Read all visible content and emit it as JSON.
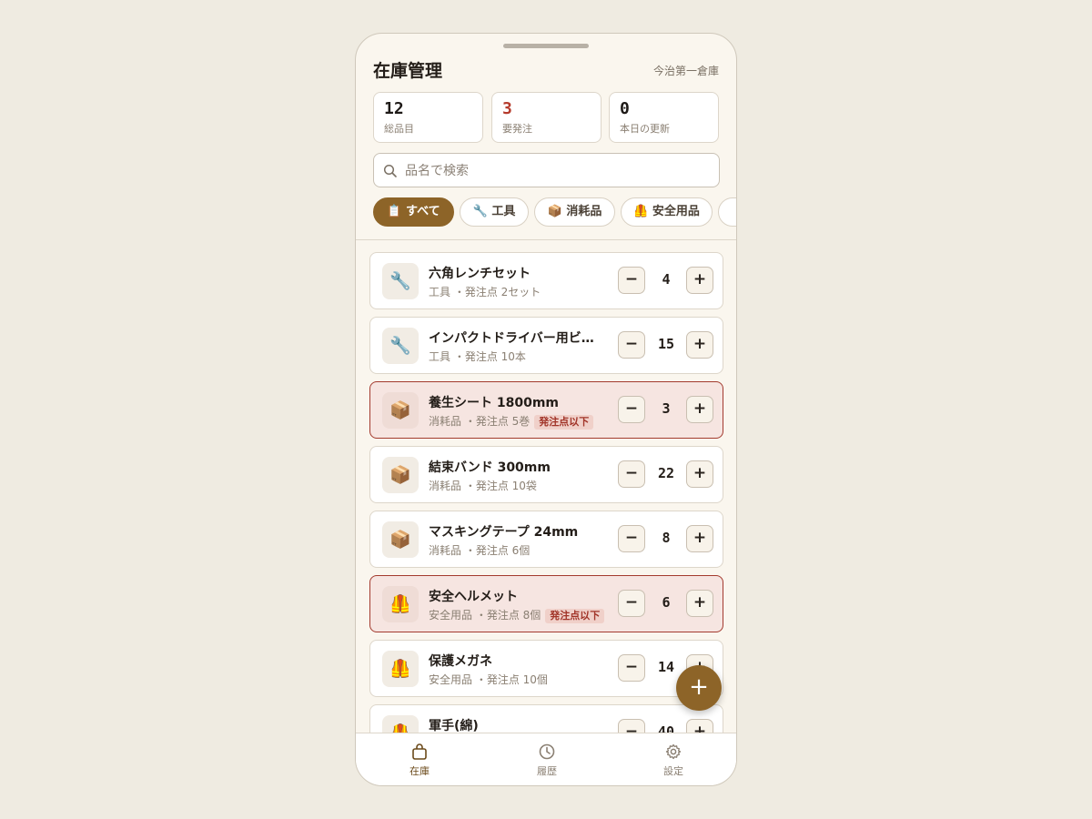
{
  "header": {
    "title": "在庫管理",
    "warehouse": "今治第一倉庫"
  },
  "stats": [
    {
      "value": "12",
      "label": "総品目"
    },
    {
      "value": "3",
      "label": "要発注"
    },
    {
      "value": "0",
      "label": "本日の更新"
    }
  ],
  "search": {
    "placeholder": "品名で検索",
    "value": ""
  },
  "filters": [
    {
      "label": "📋 すべて",
      "active": true
    },
    {
      "label": "🔧 工具",
      "active": false
    },
    {
      "label": "📦 消耗品",
      "active": false
    },
    {
      "label": "🦺 安全用品",
      "active": false
    }
  ],
  "items": [
    {
      "icon": "🔧",
      "name": "六角レンチセット",
      "category": "工具",
      "reorder": "・発注点 2セット",
      "qty": "4",
      "low": false
    },
    {
      "icon": "🔧",
      "name": "インパクトドライバー用ビ…",
      "category": "工具",
      "reorder": "・発注点 10本",
      "qty": "15",
      "low": false
    },
    {
      "icon": "📦",
      "name": "養生シート 1800mm",
      "category": "消耗品",
      "reorder": "・発注点 5巻",
      "qty": "3",
      "low": true,
      "badge": "発注点以下"
    },
    {
      "icon": "📦",
      "name": "結束バンド 300mm",
      "category": "消耗品",
      "reorder": "・発注点 10袋",
      "qty": "22",
      "low": false
    },
    {
      "icon": "📦",
      "name": "マスキングテープ 24mm",
      "category": "消耗品",
      "reorder": "・発注点 6個",
      "qty": "8",
      "low": false
    },
    {
      "icon": "🦺",
      "name": "安全ヘルメット",
      "category": "安全用品",
      "reorder": "・発注点 8個",
      "qty": "6",
      "low": true,
      "badge": "発注点以下"
    },
    {
      "icon": "🦺",
      "name": "保護メガネ",
      "category": "安全用品",
      "reorder": "・発注点 10個",
      "qty": "14",
      "low": false
    },
    {
      "icon": "🦺",
      "name": "軍手(綿)",
      "category": "",
      "reorder": "",
      "qty": "40",
      "low": false
    }
  ],
  "buttons": {
    "minus": "−",
    "plus": "+",
    "fab": "+"
  },
  "nav": [
    {
      "label": "在庫",
      "icon": "bag-icon",
      "active": true
    },
    {
      "label": "履歴",
      "icon": "clock-icon",
      "active": false
    },
    {
      "label": "設定",
      "icon": "gear-icon",
      "active": false
    }
  ],
  "colors": {
    "accent": "#8d6428",
    "alert": "#b53b2c",
    "background": "#faf6ee"
  }
}
